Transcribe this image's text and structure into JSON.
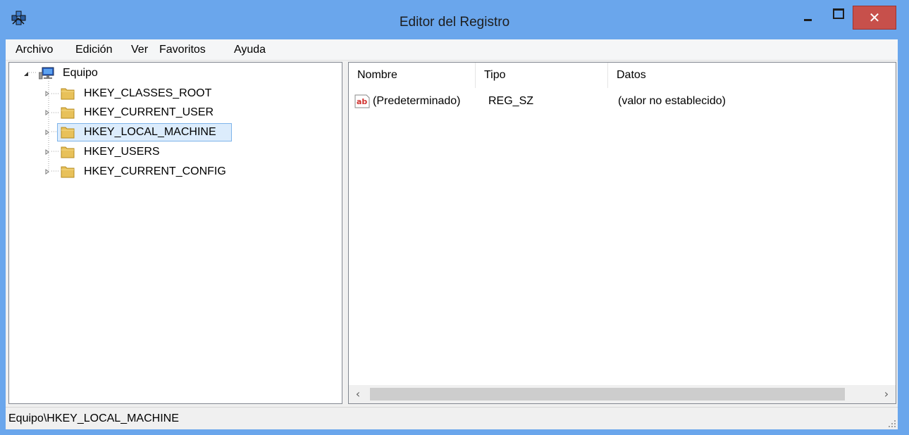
{
  "window": {
    "title": "Editor del Registro"
  },
  "menu": [
    "Archivo",
    "Edición",
    "Ver",
    "Favoritos",
    "Ayuda"
  ],
  "tree": {
    "root": "Equipo",
    "children": [
      {
        "label": "HKEY_CLASSES_ROOT",
        "selected": false
      },
      {
        "label": "HKEY_CURRENT_USER",
        "selected": false
      },
      {
        "label": "HKEY_LOCAL_MACHINE",
        "selected": true
      },
      {
        "label": "HKEY_USERS",
        "selected": false
      },
      {
        "label": "HKEY_CURRENT_CONFIG",
        "selected": false
      }
    ]
  },
  "list": {
    "columns": [
      "Nombre",
      "Tipo",
      "Datos"
    ],
    "rows": [
      {
        "name": "(Predeterminado)",
        "type": "REG_SZ",
        "data": "(valor no establecido)",
        "icon": "string-value-icon"
      }
    ]
  },
  "status": {
    "path": "Equipo\\HKEY_LOCAL_MACHINE"
  },
  "colors": {
    "titlebar": "#6aa6ec",
    "close": "#c7504b",
    "selection": "#dcecfc",
    "selection_border": "#7eb4ea"
  }
}
